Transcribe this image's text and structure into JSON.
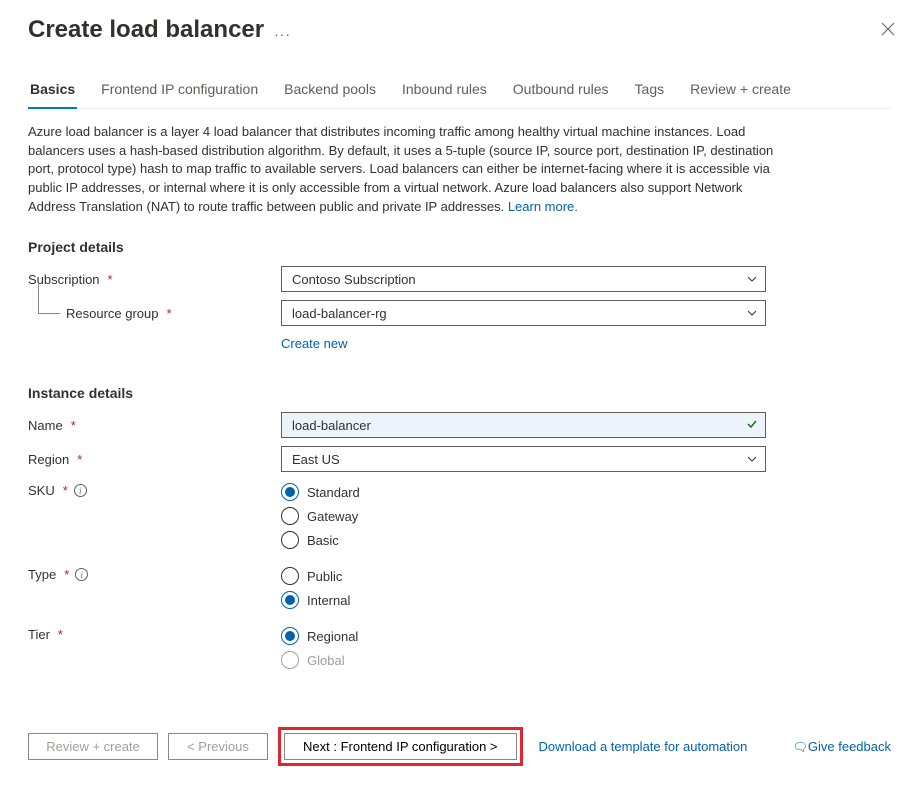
{
  "header": {
    "title": "Create load balancer"
  },
  "tabs": {
    "basics": "Basics",
    "frontend": "Frontend IP configuration",
    "backend": "Backend pools",
    "inbound": "Inbound rules",
    "outbound": "Outbound rules",
    "tags": "Tags",
    "review": "Review + create"
  },
  "description": {
    "text": "Azure load balancer is a layer 4 load balancer that distributes incoming traffic among healthy virtual machine instances. Load balancers uses a hash-based distribution algorithm. By default, it uses a 5-tuple (source IP, source port, destination IP, destination port, protocol type) hash to map traffic to available servers. Load balancers can either be internet-facing where it is accessible via public IP addresses, or internal where it is only accessible from a virtual network. Azure load balancers also support Network Address Translation (NAT) to route traffic between public and private IP addresses.  ",
    "learn_more": "Learn more."
  },
  "sections": {
    "project": "Project details",
    "instance": "Instance details"
  },
  "fields": {
    "subscription": {
      "label": "Subscription",
      "value": "Contoso Subscription"
    },
    "resource_group": {
      "label": "Resource group",
      "value": "load-balancer-rg",
      "create_new": "Create new"
    },
    "name": {
      "label": "Name",
      "value": "load-balancer"
    },
    "region": {
      "label": "Region",
      "value": "East US"
    },
    "sku": {
      "label": "SKU",
      "options": {
        "standard": "Standard",
        "gateway": "Gateway",
        "basic": "Basic"
      }
    },
    "type": {
      "label": "Type",
      "options": {
        "public": "Public",
        "internal": "Internal"
      }
    },
    "tier": {
      "label": "Tier",
      "options": {
        "regional": "Regional",
        "global": "Global"
      }
    }
  },
  "footer": {
    "review": "Review + create",
    "previous": "< Previous",
    "next": "Next : Frontend IP configuration >",
    "download": "Download a template for automation",
    "feedback": "Give feedback"
  }
}
